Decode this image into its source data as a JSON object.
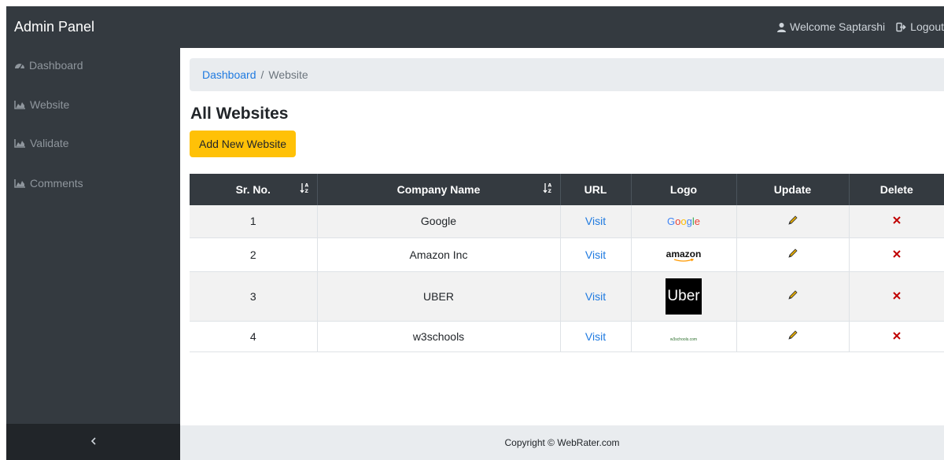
{
  "header": {
    "brand": "Admin Panel",
    "welcome_text": "Welcome Saptarshi",
    "logout_label": "Logout"
  },
  "sidebar": {
    "items": [
      {
        "label": "Dashboard",
        "icon": "dashboard-icon"
      },
      {
        "label": "Website",
        "icon": "area-chart-icon"
      },
      {
        "label": "Validate",
        "icon": "area-chart-icon"
      },
      {
        "label": "Comments",
        "icon": "area-chart-icon"
      }
    ],
    "toggle_icon": "chevron-left-icon"
  },
  "breadcrumb": {
    "link": "Dashboard",
    "separator": "/",
    "current": "Website"
  },
  "main": {
    "title": "All Websites",
    "add_button_label": "Add New Website",
    "accent_color": "#ffc107"
  },
  "table": {
    "columns": [
      "Sr. No.",
      "Company Name",
      "URL",
      "Logo",
      "Update",
      "Delete"
    ],
    "rows": [
      {
        "sr": "1",
        "company": "Google",
        "url_label": "Visit",
        "logo": "Google"
      },
      {
        "sr": "2",
        "company": "Amazon Inc",
        "url_label": "Visit",
        "logo": "amazon"
      },
      {
        "sr": "3",
        "company": "UBER",
        "url_label": "Visit",
        "logo": "Uber"
      },
      {
        "sr": "4",
        "company": "w3schools",
        "url_label": "Visit",
        "logo": "w3schools.com"
      }
    ]
  },
  "footer": {
    "copyright": "Copyright © WebRater.com"
  }
}
